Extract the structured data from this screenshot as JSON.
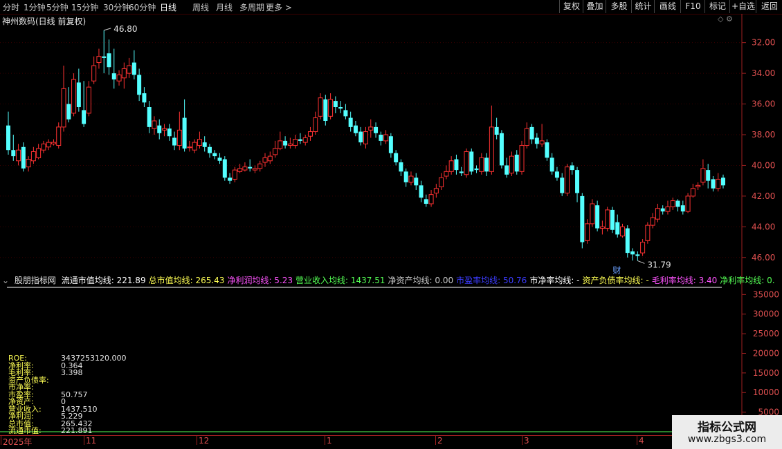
{
  "toolbar": {
    "periods": [
      "分时",
      "1分钟",
      "5分钟",
      "15分钟",
      "30分钟",
      "60分钟",
      "日线",
      "周线",
      "月线",
      "多周期",
      "更多 >"
    ],
    "active_period": "日线",
    "right_buttons": [
      "复权",
      "叠加",
      "多股",
      "统计",
      "画线",
      "F10",
      "标记",
      "+自选",
      "返回"
    ]
  },
  "stock": {
    "title": "神州数码(日线 前复权)",
    "title_icons": "◇ ⚙"
  },
  "price_panel": {
    "high_label": "46.80",
    "low_label": "31.79",
    "event_marker": "财",
    "y_ticks": [
      "46.00",
      "44.00",
      "42.00",
      "40.00",
      "38.00",
      "36.00",
      "34.00",
      "32.00"
    ]
  },
  "indicator": {
    "name": "股朋指标网",
    "header_items": [
      {
        "text": "流通市值均线: 221.89",
        "color": "#ffffff"
      },
      {
        "text": "总市值均线: 265.43",
        "color": "#ffff54"
      },
      {
        "text": "净利润均线: 5.23",
        "color": "#ff54ff"
      },
      {
        "text": "营业收入均线: 1437.51",
        "color": "#54ff54"
      },
      {
        "text": "净资产均线: 0.00",
        "color": "#c8c8c8"
      },
      {
        "text": "市盈率均线: 50.76",
        "color": "#3c3cff"
      },
      {
        "text": "市净率均线: -",
        "color": "#ffffff"
      },
      {
        "text": "资产负债率均线: -",
        "color": "#ffff54"
      },
      {
        "text": "毛利率均线: 3.40",
        "color": "#ff54ff"
      },
      {
        "text": "净利率均线: 0.",
        "color": "#54ff54"
      }
    ],
    "y_ticks": [
      "35000",
      "30000",
      "25000",
      "20000",
      "15000",
      "10000",
      "5000",
      "0"
    ],
    "rows": [
      {
        "label": "ROE:",
        "value": "3437253120.000"
      },
      {
        "label": "净利率:",
        "value": "0.364"
      },
      {
        "label": "毛利率:",
        "value": "3.398"
      },
      {
        "label": "资产负债率:",
        "value": ""
      },
      {
        "label": "市净率:",
        "value": ""
      },
      {
        "label": "市盈率:",
        "value": "50.757"
      },
      {
        "label": "净资产:",
        "value": "0"
      },
      {
        "label": "营业收入:",
        "value": "1437.510"
      },
      {
        "label": "净利润:",
        "value": "5.229"
      },
      {
        "label": "总市值:",
        "value": "265.432"
      },
      {
        "label": "流通市值:",
        "value": "221.891"
      }
    ]
  },
  "date_axis": [
    "2025年",
    "11",
    "12",
    "1",
    "2",
    "3",
    "4"
  ],
  "watermark": {
    "title": "指标公式网",
    "url": "www.zbgs3.com"
  },
  "colors": {
    "up": "#ff3232",
    "down": "#54ffff",
    "bg": "#000000",
    "grid": "#3a0000"
  },
  "chart_data": {
    "type": "candlestick",
    "title": "神州数码(日线 前复权)",
    "ylim": [
      31.0,
      47.2
    ],
    "y_ticks": [
      32,
      34,
      36,
      38,
      40,
      42,
      44,
      46
    ],
    "high": 46.8,
    "low": 31.79,
    "candles": [
      [
        40.6,
        39.0,
        41.5,
        38.7
      ],
      [
        39.0,
        38.6,
        40.0,
        38.3
      ],
      [
        38.3,
        39.0,
        39.4,
        38.0
      ],
      [
        39.2,
        37.8,
        39.5,
        37.6
      ],
      [
        37.9,
        38.4,
        38.6,
        37.6
      ],
      [
        38.3,
        38.9,
        39.2,
        38.1
      ],
      [
        38.5,
        39.1,
        39.4,
        38.4
      ],
      [
        39.0,
        39.4,
        39.6,
        38.8
      ],
      [
        39.2,
        39.5,
        39.7,
        39.0
      ],
      [
        39.4,
        39.5,
        39.7,
        39.3
      ],
      [
        39.3,
        40.5,
        40.8,
        39.1
      ],
      [
        40.5,
        43.0,
        44.5,
        40.2
      ],
      [
        42.0,
        41.0,
        43.1,
        40.8
      ],
      [
        41.4,
        43.6,
        44.0,
        41.2
      ],
      [
        43.4,
        41.8,
        44.3,
        41.5
      ],
      [
        41.6,
        40.7,
        43.5,
        40.5
      ],
      [
        41.4,
        43.1,
        43.5,
        41.2
      ],
      [
        43.5,
        44.5,
        45.1,
        43.3
      ],
      [
        44.7,
        45.1,
        45.6,
        44.3
      ],
      [
        45.1,
        45.0,
        46.8,
        44.0
      ],
      [
        45.3,
        44.4,
        46.2,
        43.9
      ],
      [
        44.0,
        43.6,
        45.6,
        43.0
      ],
      [
        43.5,
        43.9,
        44.2,
        43.2
      ],
      [
        43.7,
        44.3,
        44.7,
        43.0
      ],
      [
        44.0,
        44.5,
        45.0,
        43.7
      ],
      [
        44.7,
        43.9,
        45.5,
        43.6
      ],
      [
        43.9,
        42.6,
        44.3,
        42.2
      ],
      [
        42.7,
        42.1,
        43.1,
        41.8
      ],
      [
        41.8,
        40.5,
        42.2,
        40.1
      ],
      [
        40.4,
        40.9,
        41.2,
        40.0
      ],
      [
        40.6,
        40.1,
        41.0,
        39.7
      ],
      [
        40.3,
        40.4,
        40.7,
        39.9
      ],
      [
        40.4,
        39.9,
        40.7,
        39.6
      ],
      [
        39.8,
        39.3,
        40.2,
        39.0
      ],
      [
        39.3,
        40.3,
        41.5,
        39.0
      ],
      [
        41.1,
        39.1,
        42.3,
        38.9
      ],
      [
        39.2,
        39.2,
        39.6,
        38.9
      ],
      [
        39.0,
        39.5,
        39.7,
        38.8
      ],
      [
        39.3,
        39.7,
        40.2,
        39.1
      ],
      [
        39.5,
        39.2,
        39.9,
        38.9
      ],
      [
        39.2,
        38.8,
        39.4,
        38.5
      ],
      [
        38.8,
        38.6,
        39.0,
        38.4
      ],
      [
        38.5,
        38.3,
        38.8,
        38.1
      ],
      [
        38.4,
        37.2,
        38.6,
        37.0
      ],
      [
        37.2,
        37.0,
        37.5,
        36.8
      ],
      [
        37.1,
        37.7,
        37.9,
        36.9
      ],
      [
        37.6,
        37.8,
        38.1,
        37.5
      ],
      [
        37.7,
        37.9,
        38.2,
        37.6
      ],
      [
        37.9,
        37.8,
        38.4,
        37.6
      ],
      [
        37.7,
        37.8,
        38.0,
        37.5
      ],
      [
        37.8,
        38.1,
        38.3,
        37.6
      ],
      [
        38.2,
        38.5,
        38.8,
        37.9
      ],
      [
        38.3,
        38.6,
        38.9,
        38.1
      ],
      [
        38.7,
        39.1,
        39.6,
        38.5
      ],
      [
        39.1,
        39.6,
        40.2,
        39.0
      ],
      [
        39.6,
        39.3,
        39.9,
        39.1
      ],
      [
        39.3,
        39.4,
        39.8,
        39.1
      ],
      [
        39.3,
        39.7,
        40.0,
        39.1
      ],
      [
        39.7,
        39.6,
        40.1,
        39.4
      ],
      [
        39.5,
        39.8,
        40.0,
        39.3
      ],
      [
        39.9,
        40.2,
        40.5,
        39.6
      ],
      [
        40.2,
        41.1,
        41.5,
        40.0
      ],
      [
        41.2,
        42.4,
        42.7,
        41.0
      ],
      [
        42.3,
        40.9,
        42.6,
        40.6
      ],
      [
        41.2,
        42.3,
        42.7,
        41.0
      ],
      [
        42.2,
        41.8,
        42.5,
        41.4
      ],
      [
        41.8,
        41.7,
        42.2,
        41.4
      ],
      [
        41.6,
        41.2,
        42.0,
        41.0
      ],
      [
        41.1,
        40.5,
        41.5,
        40.2
      ],
      [
        40.6,
        40.1,
        40.9,
        39.9
      ],
      [
        40.2,
        39.5,
        40.5,
        39.3
      ],
      [
        39.4,
        40.2,
        40.5,
        39.1
      ],
      [
        40.3,
        40.5,
        41.0,
        39.8
      ],
      [
        40.5,
        40.1,
        40.8,
        39.8
      ],
      [
        40.0,
        39.6,
        40.2,
        39.3
      ],
      [
        39.6,
        40.0,
        40.3,
        39.4
      ],
      [
        39.9,
        38.8,
        40.1,
        38.5
      ],
      [
        38.8,
        38.2,
        39.0,
        38.0
      ],
      [
        38.2,
        37.6,
        38.4,
        37.3
      ],
      [
        37.6,
        36.9,
        37.8,
        36.6
      ],
      [
        36.9,
        37.3,
        37.6,
        36.7
      ],
      [
        37.2,
        36.7,
        37.5,
        36.4
      ],
      [
        36.7,
        35.9,
        37.0,
        35.6
      ],
      [
        35.8,
        35.5,
        36.1,
        35.3
      ],
      [
        35.5,
        36.1,
        36.4,
        35.3
      ],
      [
        36.2,
        36.5,
        36.8,
        35.9
      ],
      [
        36.6,
        37.2,
        37.5,
        36.4
      ],
      [
        37.3,
        37.6,
        38.0,
        37.1
      ],
      [
        37.6,
        38.3,
        38.6,
        37.4
      ],
      [
        38.4,
        37.7,
        38.7,
        37.4
      ],
      [
        37.6,
        37.5,
        37.9,
        37.3
      ],
      [
        37.4,
        38.9,
        39.1,
        37.2
      ],
      [
        38.9,
        37.6,
        39.1,
        37.4
      ],
      [
        37.8,
        37.7,
        38.0,
        37.5
      ],
      [
        37.6,
        38.5,
        38.8,
        37.4
      ],
      [
        38.5,
        37.6,
        38.8,
        37.3
      ],
      [
        37.6,
        40.5,
        41.9,
        37.4
      ],
      [
        40.5,
        40.0,
        41.1,
        39.7
      ],
      [
        40.1,
        38.0,
        40.3,
        37.8
      ],
      [
        38.0,
        37.4,
        38.5,
        37.2
      ],
      [
        37.5,
        38.6,
        38.9,
        37.3
      ],
      [
        38.7,
        37.6,
        39.0,
        37.4
      ],
      [
        37.6,
        39.3,
        39.6,
        37.4
      ],
      [
        39.3,
        40.4,
        40.8,
        39.1
      ],
      [
        40.5,
        39.7,
        40.7,
        39.4
      ],
      [
        39.8,
        39.4,
        40.1,
        39.1
      ],
      [
        39.4,
        39.6,
        40.7,
        39.2
      ],
      [
        39.5,
        38.5,
        39.7,
        38.3
      ],
      [
        38.5,
        37.6,
        38.8,
        37.4
      ],
      [
        37.6,
        37.2,
        37.9,
        37.0
      ],
      [
        37.2,
        36.2,
        37.5,
        36.0
      ],
      [
        36.2,
        37.9,
        38.1,
        36.0
      ],
      [
        38.0,
        37.7,
        38.2,
        37.4
      ],
      [
        37.7,
        36.2,
        37.9,
        35.6
      ],
      [
        36.0,
        33.0,
        36.2,
        32.6
      ],
      [
        33.1,
        34.2,
        34.5,
        32.9
      ],
      [
        34.2,
        35.5,
        35.8,
        34.0
      ],
      [
        35.4,
        33.9,
        35.7,
        33.7
      ],
      [
        33.9,
        34.0,
        34.4,
        33.5
      ],
      [
        33.9,
        35.1,
        35.3,
        33.7
      ],
      [
        35.1,
        33.8,
        35.3,
        33.6
      ],
      [
        34.3,
        33.5,
        34.8,
        33.3
      ],
      [
        33.4,
        34.0,
        34.2,
        33.3
      ],
      [
        33.9,
        32.3,
        34.1,
        32.0
      ],
      [
        32.4,
        32.2,
        32.6,
        31.8
      ],
      [
        32.2,
        32.1,
        32.4,
        31.79
      ],
      [
        32.3,
        33.0,
        33.2,
        32.1
      ],
      [
        33.1,
        34.1,
        34.3,
        32.9
      ],
      [
        34.1,
        34.6,
        34.9,
        33.9
      ],
      [
        34.5,
        35.2,
        35.5,
        34.3
      ],
      [
        35.2,
        35.0,
        35.4,
        34.8
      ],
      [
        35.0,
        35.3,
        35.7,
        34.8
      ],
      [
        35.3,
        35.7,
        35.9,
        35.1
      ],
      [
        35.7,
        35.3,
        35.8,
        35.0
      ],
      [
        35.4,
        35.0,
        35.7,
        34.8
      ],
      [
        35.0,
        36.0,
        36.2,
        34.9
      ],
      [
        36.0,
        36.5,
        36.8,
        35.9
      ],
      [
        36.6,
        36.7,
        36.9,
        36.4
      ],
      [
        36.9,
        37.8,
        38.4,
        36.7
      ],
      [
        37.7,
        37.0,
        38.1,
        36.5
      ],
      [
        37.1,
        36.5,
        37.3,
        36.3
      ],
      [
        36.5,
        37.1,
        37.5,
        36.3
      ],
      [
        37.2,
        36.7,
        37.4,
        36.5
      ]
    ],
    "indicator_ylim": [
      0,
      37000
    ]
  }
}
